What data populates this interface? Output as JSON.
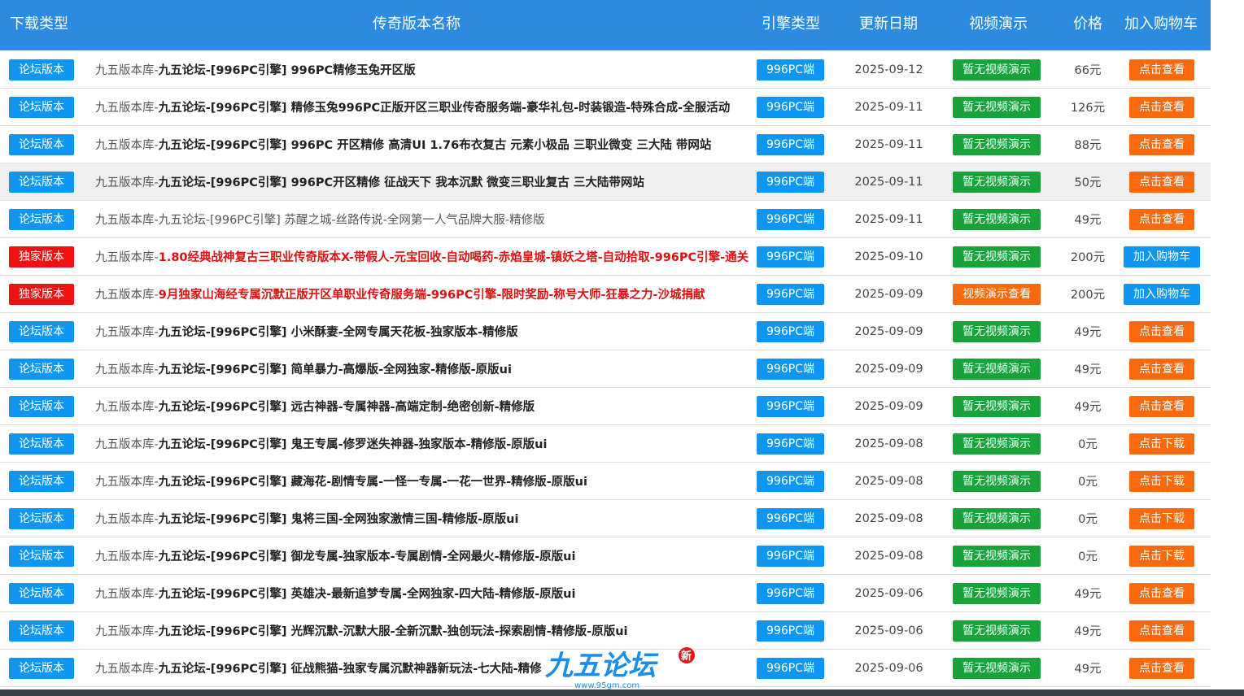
{
  "header": {
    "col_type": "下载类型",
    "col_name": "传奇版本名称",
    "col_engine": "引擎类型",
    "col_date": "更新日期",
    "col_video": "视频演示",
    "col_price": "价格",
    "col_cart": "加入购物车"
  },
  "logo": {
    "text": "九五论坛",
    "sub": "www.95gm.com",
    "tag": "新"
  },
  "colors": {
    "header": "#2a8be0",
    "blue_badge": "#0e96f2",
    "red_badge": "#ef1212",
    "green_badge": "#18a23a",
    "orange_button": "#fa6a0c"
  },
  "rows": [
    {
      "type": "论坛版本",
      "type_color": "blue",
      "prefix": "九五版本库-",
      "bold": "九五论坛-[996PC引擎] 996PC精修玉兔开区版",
      "rest": "",
      "style": "bold",
      "engine": "996PC端",
      "date": "2025-09-12",
      "video": "暂无视频演示",
      "video_color": "green",
      "price": "66元",
      "action": "点击查看",
      "action_color": "orange",
      "highlight": false
    },
    {
      "type": "论坛版本",
      "type_color": "blue",
      "prefix": "九五版本库-",
      "bold": "九五论坛-[996PC引擎] 精修玉兔996PC正版开区三职业传奇服务端-豪华礼包-时装锻造-特殊合成-全服活动",
      "rest": "",
      "style": "bold",
      "engine": "996PC端",
      "date": "2025-09-11",
      "video": "暂无视频演示",
      "video_color": "green",
      "price": "126元",
      "action": "点击查看",
      "action_color": "orange",
      "highlight": false
    },
    {
      "type": "论坛版本",
      "type_color": "blue",
      "prefix": "九五版本库-",
      "bold": "九五论坛-[996PC引擎] 996PC 开区精修 高清UI 1.76布衣复古 元素小极品 三职业微变 三大陆 带网站",
      "rest": "",
      "style": "bold",
      "engine": "996PC端",
      "date": "2025-09-11",
      "video": "暂无视频演示",
      "video_color": "green",
      "price": "88元",
      "action": "点击查看",
      "action_color": "orange",
      "highlight": false
    },
    {
      "type": "论坛版本",
      "type_color": "blue",
      "prefix": "九五版本库-",
      "bold": "九五论坛-[996PC引擎] 996PC开区精修 征战天下 我本沉默 微变三职业复古 三大陆带网站",
      "rest": "",
      "style": "bold",
      "engine": "996PC端",
      "date": "2025-09-11",
      "video": "暂无视频演示",
      "video_color": "green",
      "price": "50元",
      "action": "点击查看",
      "action_color": "orange",
      "highlight": true
    },
    {
      "type": "论坛版本",
      "type_color": "blue",
      "prefix": "九五版本库-",
      "bold": "",
      "rest": "九五论坛-[996PC引擎] 苏醒之城-丝路传说-全网第一人气品牌大服-精修版",
      "style": "normal",
      "engine": "996PC端",
      "date": "2025-09-11",
      "video": "暂无视频演示",
      "video_color": "green",
      "price": "49元",
      "action": "点击查看",
      "action_color": "orange",
      "highlight": false
    },
    {
      "type": "独家版本",
      "type_color": "red",
      "prefix": "九五版本库-",
      "bold": "1.80经典战神复古三职业传奇版本X-带假人-元宝回收-自动喝药-赤焰皇城-镇妖之塔-自动拾取-996PC引擎-通关",
      "rest": "",
      "style": "red",
      "engine": "996PC端",
      "date": "2025-09-10",
      "video": "暂无视频演示",
      "video_color": "green",
      "price": "200元",
      "action": "加入购物车",
      "action_color": "blue",
      "highlight": false
    },
    {
      "type": "独家版本",
      "type_color": "red",
      "prefix": "九五版本库-",
      "bold": "9月独家山海经专属沉默正版开区单职业传奇服务端-996PC引擎-限时奖励-称号大师-狂暴之力-沙城捐献",
      "rest": "",
      "style": "red",
      "engine": "996PC端",
      "date": "2025-09-09",
      "video": "视频演示查看",
      "video_color": "orange",
      "price": "200元",
      "action": "加入购物车",
      "action_color": "blue",
      "highlight": false
    },
    {
      "type": "论坛版本",
      "type_color": "blue",
      "prefix": "九五版本库-",
      "bold": "九五论坛-[996PC引擎] 小米酥妻-全网专属天花板-独家版本-精修版",
      "rest": "",
      "style": "bold",
      "engine": "996PC端",
      "date": "2025-09-09",
      "video": "暂无视频演示",
      "video_color": "green",
      "price": "49元",
      "action": "点击查看",
      "action_color": "orange",
      "highlight": false
    },
    {
      "type": "论坛版本",
      "type_color": "blue",
      "prefix": "九五版本库-",
      "bold": "九五论坛-[996PC引擎] 简单暴力-高爆版-全网独家-精修版-原版ui",
      "rest": "",
      "style": "bold",
      "engine": "996PC端",
      "date": "2025-09-09",
      "video": "暂无视频演示",
      "video_color": "green",
      "price": "49元",
      "action": "点击查看",
      "action_color": "orange",
      "highlight": false
    },
    {
      "type": "论坛版本",
      "type_color": "blue",
      "prefix": "九五版本库-",
      "bold": "九五论坛-[996PC引擎] 远古神器-专属神器-高端定制-绝密创新-精修版",
      "rest": "",
      "style": "bold",
      "engine": "996PC端",
      "date": "2025-09-09",
      "video": "暂无视频演示",
      "video_color": "green",
      "price": "49元",
      "action": "点击查看",
      "action_color": "orange",
      "highlight": false
    },
    {
      "type": "论坛版本",
      "type_color": "blue",
      "prefix": "九五版本库-",
      "bold": "九五论坛-[996PC引擎] 鬼王专属-修罗迷失神器-独家版本-精修版-原版ui",
      "rest": "",
      "style": "bold",
      "engine": "996PC端",
      "date": "2025-09-08",
      "video": "暂无视频演示",
      "video_color": "green",
      "price": "0元",
      "action": "点击下载",
      "action_color": "orange",
      "highlight": false
    },
    {
      "type": "论坛版本",
      "type_color": "blue",
      "prefix": "九五版本库-",
      "bold": "九五论坛-[996PC引擎] 藏海花-剧情专属-一怪一专属-一花一世界-精修版-原版ui",
      "rest": "",
      "style": "bold",
      "engine": "996PC端",
      "date": "2025-09-08",
      "video": "暂无视频演示",
      "video_color": "green",
      "price": "0元",
      "action": "点击下载",
      "action_color": "orange",
      "highlight": false
    },
    {
      "type": "论坛版本",
      "type_color": "blue",
      "prefix": "九五版本库-",
      "bold": "九五论坛-[996PC引擎] 鬼将三国-全网独家激情三国-精修版-原版ui",
      "rest": "",
      "style": "bold",
      "engine": "996PC端",
      "date": "2025-09-08",
      "video": "暂无视频演示",
      "video_color": "green",
      "price": "0元",
      "action": "点击下载",
      "action_color": "orange",
      "highlight": false
    },
    {
      "type": "论坛版本",
      "type_color": "blue",
      "prefix": "九五版本库-",
      "bold": "九五论坛-[996PC引擎] 御龙专属-独家版本-专属剧情-全网最火-精修版-原版ui",
      "rest": "",
      "style": "bold",
      "engine": "996PC端",
      "date": "2025-09-08",
      "video": "暂无视频演示",
      "video_color": "green",
      "price": "0元",
      "action": "点击下载",
      "action_color": "orange",
      "highlight": false
    },
    {
      "type": "论坛版本",
      "type_color": "blue",
      "prefix": "九五版本库-",
      "bold": "九五论坛-[996PC引擎] 英雄决-最新追梦专属-全网独家-四大陆-精修版-原版ui",
      "rest": "",
      "style": "bold",
      "engine": "996PC端",
      "date": "2025-09-06",
      "video": "暂无视频演示",
      "video_color": "green",
      "price": "49元",
      "action": "点击查看",
      "action_color": "orange",
      "highlight": false
    },
    {
      "type": "论坛版本",
      "type_color": "blue",
      "prefix": "九五版本库-",
      "bold": "九五论坛-[996PC引擎] 光辉沉默-沉默大服-全新沉默-独创玩法-探索剧情-精修版-原版ui",
      "rest": "",
      "style": "bold",
      "engine": "996PC端",
      "date": "2025-09-06",
      "video": "暂无视频演示",
      "video_color": "green",
      "price": "49元",
      "action": "点击查看",
      "action_color": "orange",
      "highlight": false
    },
    {
      "type": "论坛版本",
      "type_color": "blue",
      "prefix": "九五版本库-",
      "bold": "九五论坛-[996PC引擎] 征战熊猫-独家专属沉默神器新玩法-七大陆-精修",
      "rest": "",
      "style": "bold",
      "engine": "996PC端",
      "date": "2025-09-06",
      "video": "暂无视频演示",
      "video_color": "green",
      "price": "49元",
      "action": "点击查看",
      "action_color": "orange",
      "highlight": false
    }
  ]
}
